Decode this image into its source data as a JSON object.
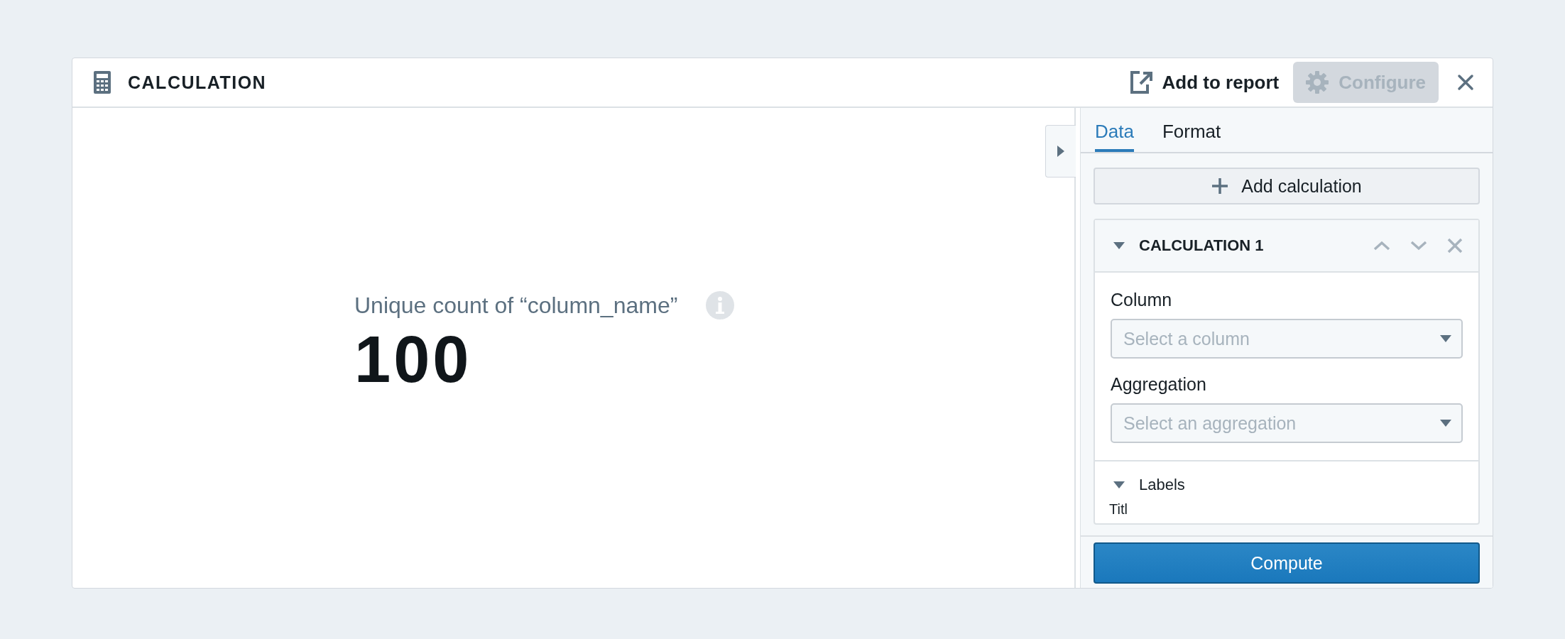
{
  "window": {
    "title": "CALCULATION"
  },
  "header_actions": [
    {
      "kind": "link",
      "label": "Add to report",
      "disabled": false
    },
    {
      "kind": "button",
      "label": "Configure",
      "disabled": true
    }
  ],
  "metric": {
    "label": "Unique count of “column_name”",
    "value": "100"
  },
  "tabs": [
    {
      "label": "Data",
      "selected": true
    },
    {
      "label": "Format",
      "selected": false
    }
  ],
  "add_button": {
    "label": "Add calculation"
  },
  "calculation": {
    "title": "CALCULATION 1",
    "expanded": true,
    "fields": [
      {
        "label": "Column",
        "placeholder": "Select a column"
      },
      {
        "label": "Aggregation",
        "placeholder": "Select an aggregation"
      }
    ],
    "sections": [
      {
        "label": "Labels",
        "expanded": true,
        "cut_text": "Titl"
      }
    ]
  },
  "compute_button": {
    "label": "Compute"
  }
}
